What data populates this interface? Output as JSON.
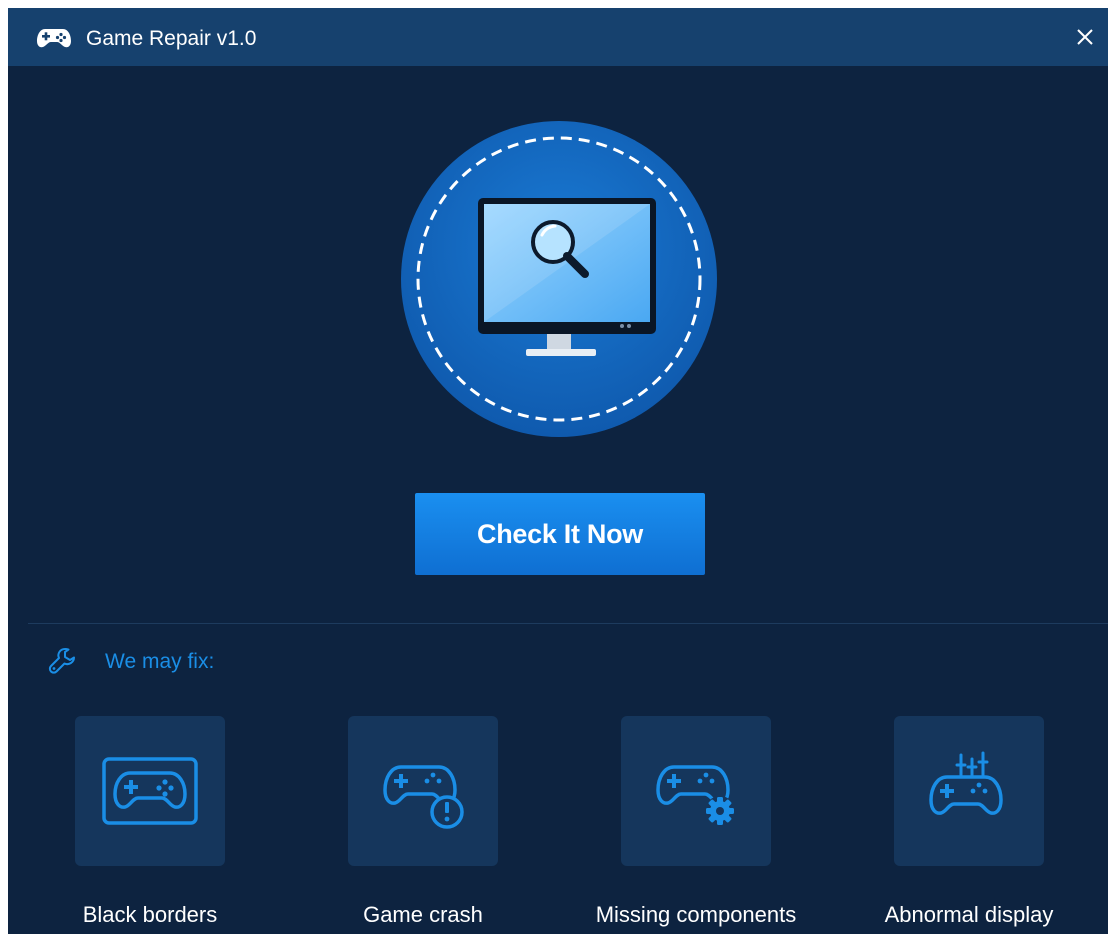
{
  "window": {
    "title": "Game Repair v1.0",
    "app_icon": "gamepad-icon",
    "close_icon": "close-icon"
  },
  "hero": {
    "icon": "monitor-search-icon"
  },
  "primary_action": {
    "label": "Check It Now"
  },
  "fix_section": {
    "header_icon": "wrench-icon",
    "header": "We may fix:",
    "items": [
      {
        "label": "Black borders",
        "icon": "gamepad-black-borders-icon"
      },
      {
        "label": "Game crash",
        "icon": "gamepad-crash-icon"
      },
      {
        "label": "Missing components",
        "icon": "gamepad-missing-components-icon"
      },
      {
        "label": "Abnormal display",
        "icon": "gamepad-abnormal-display-icon"
      }
    ]
  },
  "colors": {
    "window_bg": "#0d2340",
    "titlebar_bg": "#16416e",
    "accent": "#1a8ee6",
    "button_bg": "#1584e4",
    "tile_bg": "#15365c",
    "text": "#ffffff"
  }
}
